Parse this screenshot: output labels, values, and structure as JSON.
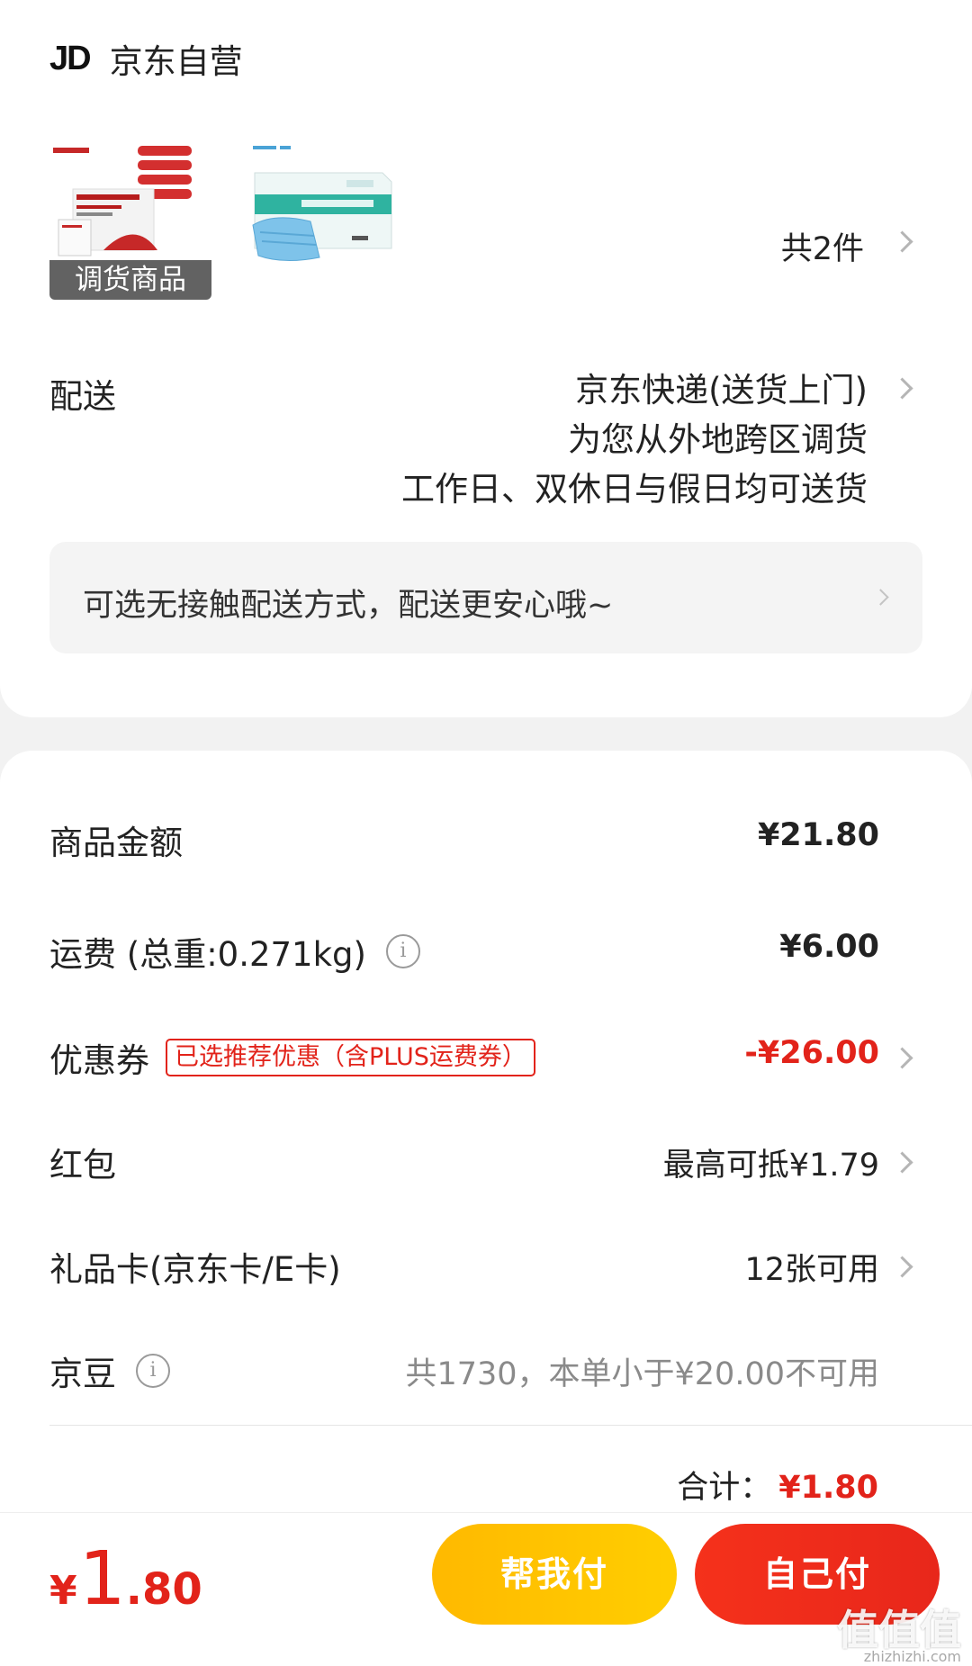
{
  "store": {
    "logo": "JD",
    "name": "京东自营"
  },
  "products": {
    "badge": "调货商品",
    "count": "共2件"
  },
  "delivery": {
    "label": "配送",
    "lines": [
      "京东快递(送货上门)",
      "为您从外地跨区调货",
      "工作日、双休日与假日均可送货"
    ],
    "contactless_text": "可选无接触配送方式，配送更安心哦~"
  },
  "pricing": {
    "goods_amount": {
      "label": "商品金额",
      "value": "¥21.80"
    },
    "shipping": {
      "label": "运费 (总重:0.271kg)",
      "value": "¥6.00"
    },
    "coupon": {
      "label": "优惠券",
      "tag": "已选推荐优惠（含PLUS运费券）",
      "value": "-¥26.00"
    },
    "red_packet": {
      "label": "红包",
      "value": "最高可抵¥1.79"
    },
    "gift_card": {
      "label": "礼品卡(京东卡/E卡)",
      "value": "12张可用"
    },
    "jd_beans": {
      "label": "京豆",
      "value": "共1730，本单小于¥20.00不可用"
    },
    "total": {
      "label": "合计：",
      "value": "¥1.80"
    }
  },
  "bottom_bar": {
    "currency": "¥",
    "amount_int": "1",
    "amount_dec": ".80",
    "help_pay_label": "帮我付",
    "self_pay_label": "自己付"
  },
  "watermark": {
    "text": "值值值",
    "sub": "zhizhizhi.com"
  },
  "colors": {
    "accent_red": "#e2231a",
    "help_yellow": "#ffc200"
  }
}
